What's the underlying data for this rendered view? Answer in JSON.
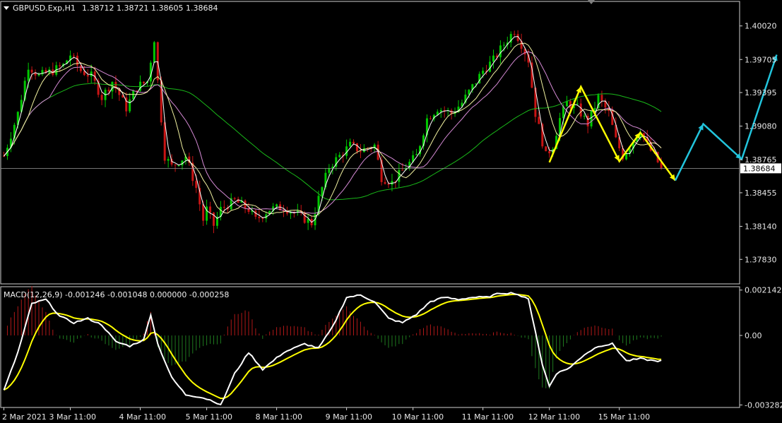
{
  "header": {
    "symbol": "GBPUSD.Exp,H1",
    "ohlc": "1.38712 1.38721 1.38605 1.38684"
  },
  "macd_header": "MACD(12,26,9) -0.001246 -0.001048 0.000000 -0.000258",
  "colors": {
    "background": "#000000",
    "frame": "#d0d0d0",
    "bull": "#00c800",
    "bear": "#c81414",
    "ma_fast": "#ffffff",
    "ma_yellow": "#f2f2a0",
    "ma_violet": "#d58ad5",
    "ma_green": "#19b819",
    "pattern": "#ffff00",
    "projection": "#22c4dc",
    "macd_line": "#ffffff",
    "signal_line": "#ffff00",
    "hist_pos": "#b01818",
    "hist_neg": "#1f7a1f"
  },
  "chart_data": [
    {
      "type": "candlestick",
      "pane": "price",
      "ylim": [
        1.376,
        1.4025
      ],
      "yticks": [
        "1.40020",
        "1.39705",
        "1.39395",
        "1.39080",
        "1.38765",
        "1.38455",
        "1.38140",
        "1.37830"
      ],
      "ytick_values": [
        1.4002,
        1.39705,
        1.39395,
        1.3908,
        1.38765,
        1.38455,
        1.3814,
        1.3783
      ],
      "current_price": "1.38684",
      "current_value": 1.38684,
      "xticks": [
        "2 Mar 2021",
        "3 Mar 11:00",
        "4 Mar 11:00",
        "5 Mar 11:00",
        "8 Mar 11:00",
        "9 Mar 11:00",
        "10 Mar 11:00",
        "11 Mar 11:00",
        "12 Mar 11:00",
        "15 Mar 11:00"
      ],
      "bars": 189,
      "price_path": [
        [
          0,
          1.388
        ],
        [
          4,
          1.392
        ],
        [
          7,
          1.3965
        ],
        [
          10,
          1.3955
        ],
        [
          14,
          1.396
        ],
        [
          17,
          1.3965
        ],
        [
          19,
          1.3975
        ],
        [
          22,
          1.396
        ],
        [
          25,
          1.3955
        ],
        [
          28,
          1.3935
        ],
        [
          31,
          1.395
        ],
        [
          35,
          1.3925
        ],
        [
          38,
          1.3945
        ],
        [
          41,
          1.395
        ],
        [
          43,
          1.399
        ],
        [
          44,
          1.395
        ],
        [
          46,
          1.388
        ],
        [
          48,
          1.387
        ],
        [
          52,
          1.388
        ],
        [
          55,
          1.385
        ],
        [
          57,
          1.382
        ],
        [
          58,
          1.383
        ],
        [
          60,
          1.3815
        ],
        [
          62,
          1.383
        ],
        [
          66,
          1.3838
        ],
        [
          70,
          1.383
        ],
        [
          72,
          1.382
        ],
        [
          76,
          1.383
        ],
        [
          80,
          1.3832
        ],
        [
          84,
          1.3825
        ],
        [
          88,
          1.3817
        ],
        [
          90,
          1.384
        ],
        [
          93,
          1.387
        ],
        [
          96,
          1.388
        ],
        [
          99,
          1.389
        ],
        [
          102,
          1.3885
        ],
        [
          106,
          1.389
        ],
        [
          108,
          1.386
        ],
        [
          111,
          1.3855
        ],
        [
          115,
          1.387
        ],
        [
          118,
          1.388
        ],
        [
          121,
          1.3915
        ],
        [
          124,
          1.3925
        ],
        [
          128,
          1.392
        ],
        [
          131,
          1.393
        ],
        [
          134,
          1.3945
        ],
        [
          137,
          1.396
        ],
        [
          140,
          1.397
        ],
        [
          143,
          1.3985
        ],
        [
          146,
          1.3998
        ],
        [
          148,
          1.3985
        ],
        [
          150,
          1.397
        ],
        [
          152,
          1.392
        ],
        [
          155,
          1.388
        ],
        [
          157,
          1.389
        ],
        [
          159,
          1.3915
        ],
        [
          161,
          1.393
        ],
        [
          164,
          1.3925
        ],
        [
          167,
          1.391
        ],
        [
          170,
          1.3935
        ],
        [
          173,
          1.392
        ],
        [
          175,
          1.3895
        ],
        [
          177,
          1.388
        ],
        [
          180,
          1.3895
        ],
        [
          182,
          1.3905
        ],
        [
          184,
          1.389
        ],
        [
          186,
          1.388
        ],
        [
          188,
          1.38684
        ]
      ],
      "pattern_points": [
        [
          1.3874,
          156
        ],
        [
          1.3945,
          165
        ],
        [
          1.3875,
          176
        ],
        [
          1.3902,
          182
        ],
        [
          1.3857,
          192
        ]
      ],
      "projection_points": [
        [
          1.3857,
          192
        ],
        [
          1.391,
          200
        ],
        [
          1.3877,
          211
        ],
        [
          1.3975,
          221
        ]
      ],
      "ma_periods": {
        "white": 3,
        "yellow": 8,
        "violet": 14,
        "green": 48
      }
    },
    {
      "type": "macd",
      "pane": "indicator",
      "ylim": [
        -0.0034,
        0.0023
      ],
      "yticks": [
        "0.002142",
        "0.00",
        "-0.003282"
      ],
      "ytick_values": [
        0.002142,
        0.0,
        -0.003282
      ],
      "macd_path": [
        [
          0,
          -0.0026
        ],
        [
          4,
          -0.0008
        ],
        [
          8,
          0.0015
        ],
        [
          12,
          0.0017
        ],
        [
          16,
          0.0009
        ],
        [
          20,
          0.0006
        ],
        [
          24,
          0.0008
        ],
        [
          28,
          0.0005
        ],
        [
          32,
          -0.0003
        ],
        [
          36,
          -0.0005
        ],
        [
          40,
          -0.0002
        ],
        [
          42,
          0.001
        ],
        [
          44,
          -0.0004
        ],
        [
          48,
          -0.002
        ],
        [
          52,
          -0.0028
        ],
        [
          56,
          -0.0029
        ],
        [
          60,
          -0.0031
        ],
        [
          62,
          -0.0033
        ],
        [
          66,
          -0.0018
        ],
        [
          70,
          -0.0008
        ],
        [
          74,
          -0.0016
        ],
        [
          80,
          -0.0008
        ],
        [
          86,
          -0.0004
        ],
        [
          90,
          -0.0006
        ],
        [
          94,
          0.0004
        ],
        [
          98,
          0.0018
        ],
        [
          102,
          0.0019
        ],
        [
          106,
          0.0016
        ],
        [
          110,
          0.0008
        ],
        [
          114,
          0.0006
        ],
        [
          118,
          0.001
        ],
        [
          122,
          0.0016
        ],
        [
          126,
          0.0018
        ],
        [
          130,
          0.0017
        ],
        [
          134,
          0.0018
        ],
        [
          138,
          0.0018
        ],
        [
          142,
          0.002
        ],
        [
          146,
          0.002
        ],
        [
          150,
          0.0017
        ],
        [
          152,
          0.0002
        ],
        [
          154,
          -0.0014
        ],
        [
          156,
          -0.0024
        ],
        [
          158,
          -0.0018
        ],
        [
          162,
          -0.0015
        ],
        [
          166,
          -0.0009
        ],
        [
          170,
          -0.0005
        ],
        [
          174,
          -0.0004
        ],
        [
          178,
          -0.0012
        ],
        [
          182,
          -0.0011
        ],
        [
          186,
          -0.0012
        ],
        [
          188,
          -0.0012
        ]
      ]
    }
  ]
}
